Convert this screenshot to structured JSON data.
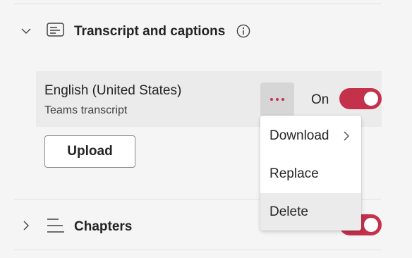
{
  "transcript_section": {
    "title": "Transcript and captions",
    "expanded": true,
    "icons": {
      "chevron": "chevron-down-icon",
      "section": "transcript-icon",
      "info": "info-icon"
    },
    "row": {
      "language": "English (United States)",
      "source": "Teams transcript",
      "more_icon": "more-horizontal-icon",
      "toggle_label": "On",
      "toggle_on": true
    },
    "upload_label": "Upload"
  },
  "menu": {
    "items": [
      {
        "label": "Download",
        "has_submenu": true
      },
      {
        "label": "Replace",
        "has_submenu": false
      },
      {
        "label": "Delete",
        "has_submenu": false,
        "highlighted": true
      }
    ]
  },
  "chapters_section": {
    "title": "Chapters",
    "expanded": false,
    "icons": {
      "chevron": "chevron-right-icon",
      "section": "chapters-icon"
    },
    "toggle_on": true
  },
  "colors": {
    "accent": "#c4314b",
    "background": "#f5f5f5",
    "row_background": "#ebebeb",
    "menu_hover": "#ebebeb"
  }
}
